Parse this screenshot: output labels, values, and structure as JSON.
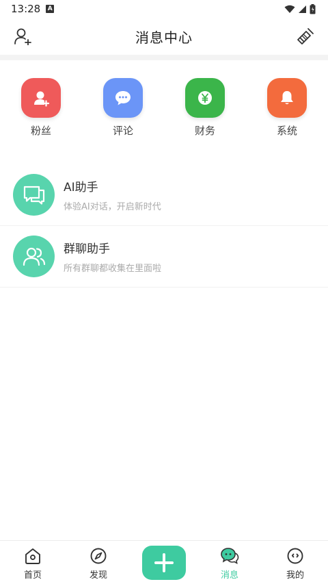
{
  "status_bar": {
    "time": "13:28",
    "badge": "A"
  },
  "header": {
    "title": "消息中心"
  },
  "quick_actions": [
    {
      "label": "粉丝",
      "color": "#ef5a5a",
      "icon": "user-plus-icon"
    },
    {
      "label": "评论",
      "color": "#6b95f7",
      "icon": "comment-icon"
    },
    {
      "label": "财务",
      "color": "#3bb54a",
      "icon": "yuan-icon"
    },
    {
      "label": "系统",
      "color": "#f36b3d",
      "icon": "bell-icon"
    }
  ],
  "messages": [
    {
      "title": "AI助手",
      "subtitle": "体验AI对话，开启新时代",
      "icon": "chat-bubbles-icon"
    },
    {
      "title": "群聊助手",
      "subtitle": "所有群聊都收集在里面啦",
      "icon": "group-icon"
    }
  ],
  "nav": {
    "items": [
      {
        "label": "首页",
        "icon": "home-icon"
      },
      {
        "label": "发现",
        "icon": "compass-icon"
      },
      {
        "label": "消息",
        "icon": "message-icon",
        "active": true
      },
      {
        "label": "我的",
        "icon": "profile-icon"
      }
    ],
    "accent": "#3ecba0"
  }
}
